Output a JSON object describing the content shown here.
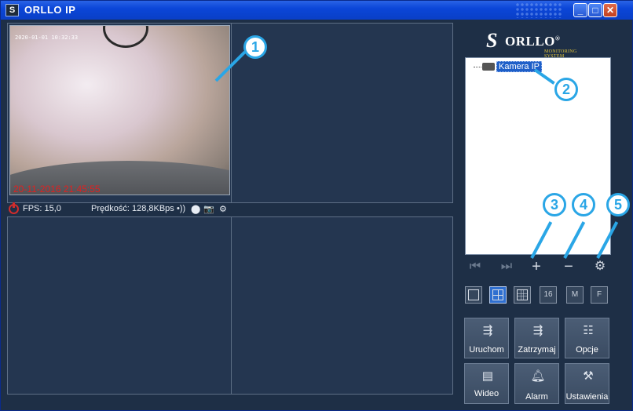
{
  "window": {
    "title": "ORLLO IP",
    "app_icon": "logo-icon",
    "minimize": "_",
    "maximize": "□",
    "close": "✕"
  },
  "video": {
    "timestamp_top": "2020-01-01  10:32:33",
    "timestamp_bottom": "20-11-2016 21:45:55"
  },
  "status": {
    "fps": "FPS: 15,0",
    "speed": "Prędkość: 128,8KBps",
    "audio_icon": "•))",
    "record_icon": "⬤",
    "snapshot_icon": "📷",
    "settings_icon": "⚙"
  },
  "callouts": [
    "1",
    "2",
    "3",
    "4",
    "5"
  ],
  "logo": {
    "mark": "S",
    "brand": "ORLLO",
    "reg": "®",
    "tagline": "MONITORING SYSTEM"
  },
  "tree": {
    "camera_label": "Kamera IP"
  },
  "controls": {
    "prev": "⏮",
    "next": "⏭",
    "add": "+",
    "remove": "−",
    "settings": "⚙"
  },
  "layouts": [
    "",
    "",
    "",
    "16",
    "M",
    "F"
  ],
  "buttons": {
    "start": "Uruchom",
    "stop": "Zatrzymaj",
    "options": "Opcje",
    "video": "Wideo",
    "alarm": "Alarm",
    "settings": "Ustawienia"
  },
  "colors": {
    "accent": "#2aa6e6",
    "titlebar": "#0b46d8",
    "background": "#1e2f46",
    "alert_red": "#e12020"
  }
}
